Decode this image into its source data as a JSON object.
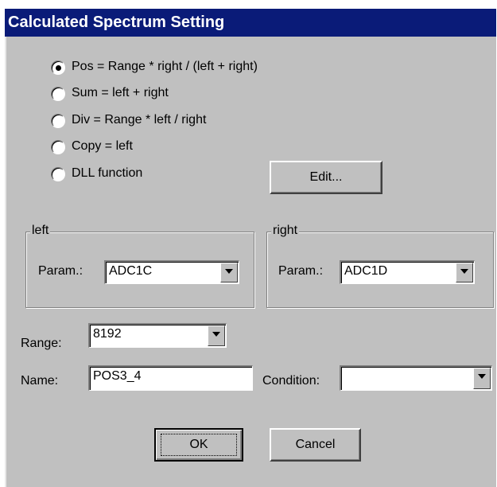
{
  "window": {
    "title": "Calculated Spectrum Setting"
  },
  "mode": {
    "options": [
      {
        "label": "Pos = Range * right / (left + right)",
        "mnemonic": "P",
        "selected": true
      },
      {
        "label": "Sum = left + right",
        "selected": false
      },
      {
        "label": "Div = Range * left / right",
        "selected": false
      },
      {
        "label": "Copy = left",
        "selected": false
      },
      {
        "label": "DLL function",
        "selected": false
      }
    ],
    "edit_button": "Edit..."
  },
  "left_group": {
    "title": "left",
    "param_label": "Param.:",
    "param_value": "ADC1C"
  },
  "right_group": {
    "title": "right",
    "param_label": "Param.:",
    "param_value": "ADC1D"
  },
  "range": {
    "label": "Range:",
    "value": "8192"
  },
  "name": {
    "label": "Name:",
    "value": "POS3_4"
  },
  "condition": {
    "label": "Condition:",
    "value": ""
  },
  "buttons": {
    "ok": "OK",
    "cancel": "Cancel"
  },
  "icons": {
    "radio_selected": "radio-selected-icon",
    "dropdown_arrow": "dropdown-arrow-icon"
  }
}
